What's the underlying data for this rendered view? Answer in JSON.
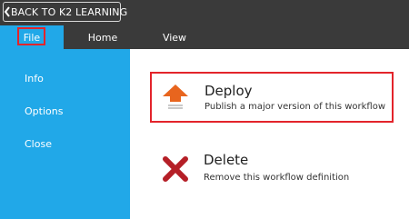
{
  "header": {
    "back_label": "BACK TO K2 LEARNING"
  },
  "tabs": [
    {
      "label": "File"
    },
    {
      "label": "Home"
    },
    {
      "label": "View"
    }
  ],
  "sidebar": {
    "items": [
      {
        "label": "Info"
      },
      {
        "label": "Options"
      },
      {
        "label": "Close"
      }
    ]
  },
  "actions": {
    "deploy": {
      "title": "Deploy",
      "description": "Publish a major version of this workflow",
      "icon": "deploy-upload-arrow-icon"
    },
    "delete": {
      "title": "Delete",
      "description": "Remove this workflow definition",
      "icon": "delete-x-icon"
    }
  },
  "colors": {
    "accent": "#21a8e8",
    "dark_bar": "#3a3a3a",
    "highlight": "#e3242b",
    "deploy_arrow": "#e8651e",
    "delete_x": "#b51f27"
  }
}
